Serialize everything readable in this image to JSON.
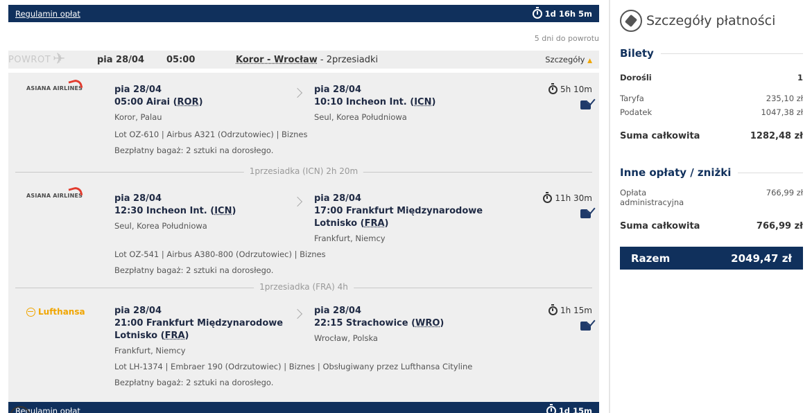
{
  "top_bar": {
    "link": "Regulamin opłat",
    "duration": "1d 16h 5m"
  },
  "days_to_return": "5 dni do powrotu",
  "return_row": {
    "label": "POWROT",
    "date": "pia 28/04",
    "time": "05:00",
    "origin": "Koror",
    "separator": " - ",
    "destination": "Wrocław",
    "stops": " - 2przesiadki",
    "details_label": "Szczegóły"
  },
  "segments": [
    {
      "airline": "ASIANA AIRLINES",
      "dep_date": "pia 28/04",
      "dep_time_place": "05:00 Airai (",
      "dep_code": "ROR",
      "dep_close": ")",
      "dep_city": "Koror, Palau",
      "arr_date": "pia 28/04",
      "arr_time_place": "10:10 Incheon Int. (",
      "arr_code": "ICN",
      "arr_close": ")",
      "arr_city": "Seul, Korea Południowa",
      "flight_info": "Lot OZ-610 | Airbus A321 (Odrzutowiec) | Biznes",
      "baggage": "Bezpłatny bagaż: 2 sztuki na dorosłego.",
      "duration": "5h 10m"
    },
    {
      "airline": "ASIANA AIRLINES",
      "dep_date": "pia 28/04",
      "dep_time_place": "12:30 Incheon Int. (",
      "dep_code": "ICN",
      "dep_close": ")",
      "dep_city": "Seul, Korea Południowa",
      "arr_date": "pia 28/04",
      "arr_line1": "17:00 Frankfurt Międzynarodowe",
      "arr_line2": "Lotnisko (",
      "arr_code": "FRA",
      "arr_close": ")",
      "arr_city": "Frankfurt, Niemcy",
      "flight_info": "Lot OZ-541 | Airbus A380-800 (Odrzutowiec) | Biznes",
      "baggage": "Bezpłatny bagaż: 2 sztuki na dorosłego.",
      "duration": "11h 30m"
    },
    {
      "airline": "Lufthansa",
      "dep_date": "pia 28/04",
      "dep_line1": "21:00 Frankfurt Międzynarodowe",
      "dep_line2": "Lotnisko (",
      "dep_code": "FRA",
      "dep_close": ")",
      "dep_city": "Frankfurt, Niemcy",
      "arr_date": "pia 28/04",
      "arr_time_place": "22:15 Strachowice (",
      "arr_code": "WRO",
      "arr_close": ")",
      "arr_city": "Wrocław, Polska",
      "flight_info": "Lot LH-1374 | Embraer 190 (Odrzutowiec) | Biznes | Obsługiwany przez Lufthansa Cityline",
      "baggage": "Bezpłatny bagaż: 2 sztuki na dorosłego.",
      "duration": "1h 15m"
    }
  ],
  "layovers": [
    "1przesiadka (ICN) 2h 20m",
    "1przesiadka (FRA) 4h"
  ],
  "bottom_bar": {
    "link": "Regulamin opłat",
    "duration": "1d 15m"
  },
  "payment": {
    "title": "Szczegóły płatności",
    "tickets_heading": "Bilety",
    "adults_label": "Dorośli",
    "adults_count": "1",
    "fare_label": "Taryfa",
    "fare_value": "235,10 zł",
    "tax_label": "Podatek",
    "tax_value": "1047,38 zł",
    "subtotal_label": "Suma całkowita",
    "subtotal_value": "1282,48 zł",
    "other_heading": "Inne opłaty / zniżki",
    "admin_label_1": "Opłata",
    "admin_label_2": "administracyjna",
    "admin_value": "766,99 zł",
    "other_total_label": "Suma całkowita",
    "other_total_value": "766,99 zł",
    "grand_label": "Razem",
    "grand_value": "2049,47 zł"
  }
}
